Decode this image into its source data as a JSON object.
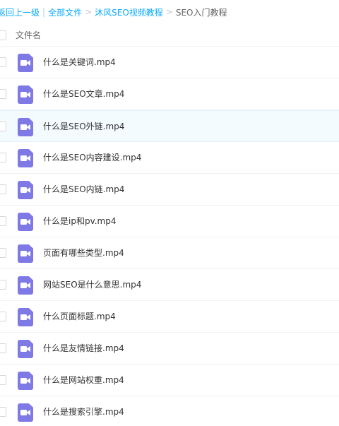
{
  "breadcrumb": {
    "back": "返回上一级",
    "all_files": "全部文件",
    "folder": "沐风SEO视频教程",
    "current": "SEO入门教程",
    "divider": "|",
    "arrow": ">"
  },
  "list_header": {
    "filename_label": "文件名"
  },
  "colors": {
    "link": "#09aaff",
    "video_icon": "#7f79e6",
    "selected_row": "#f4fbff"
  },
  "files": [
    {
      "name": "什么是关键词.mp4",
      "icon": "video-file-icon",
      "selected": false
    },
    {
      "name": "什么是SEO文章.mp4",
      "icon": "video-file-icon",
      "selected": false
    },
    {
      "name": "什么是SEO外链.mp4",
      "icon": "video-file-icon",
      "selected": true
    },
    {
      "name": "什么是SEO内容建设.mp4",
      "icon": "video-file-icon",
      "selected": false
    },
    {
      "name": "什么是SEO内链.mp4",
      "icon": "video-file-icon",
      "selected": false
    },
    {
      "name": "什么是ip和pv.mp4",
      "icon": "video-file-icon",
      "selected": false
    },
    {
      "name": "页面有哪些类型.mp4",
      "icon": "video-file-icon",
      "selected": false
    },
    {
      "name": "网站SEO是什么意思.mp4",
      "icon": "video-file-icon",
      "selected": false
    },
    {
      "name": "什么页面标题.mp4",
      "icon": "video-file-icon",
      "selected": false
    },
    {
      "name": "什么是友情链接.mp4",
      "icon": "video-file-icon",
      "selected": false
    },
    {
      "name": "什么是网站权重.mp4",
      "icon": "video-file-icon",
      "selected": false
    },
    {
      "name": "什么是搜索引擎.mp4",
      "icon": "video-file-icon",
      "selected": false
    }
  ]
}
